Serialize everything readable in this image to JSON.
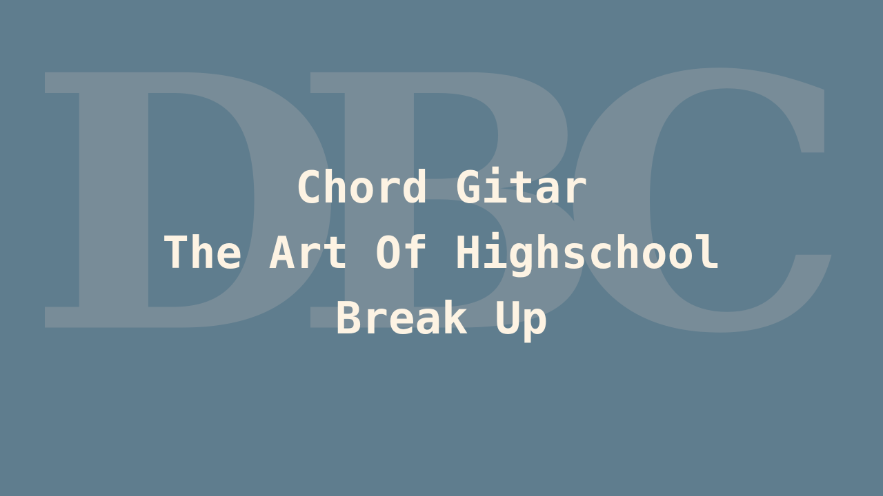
{
  "background": {
    "color": "#5f7d8e",
    "watermark_text": "DBC",
    "watermark_color": "#788c98"
  },
  "title": {
    "color": "#fdf3e3",
    "lines": [
      "Chord Gitar",
      "The Art Of Highschool",
      "Break Up"
    ]
  }
}
